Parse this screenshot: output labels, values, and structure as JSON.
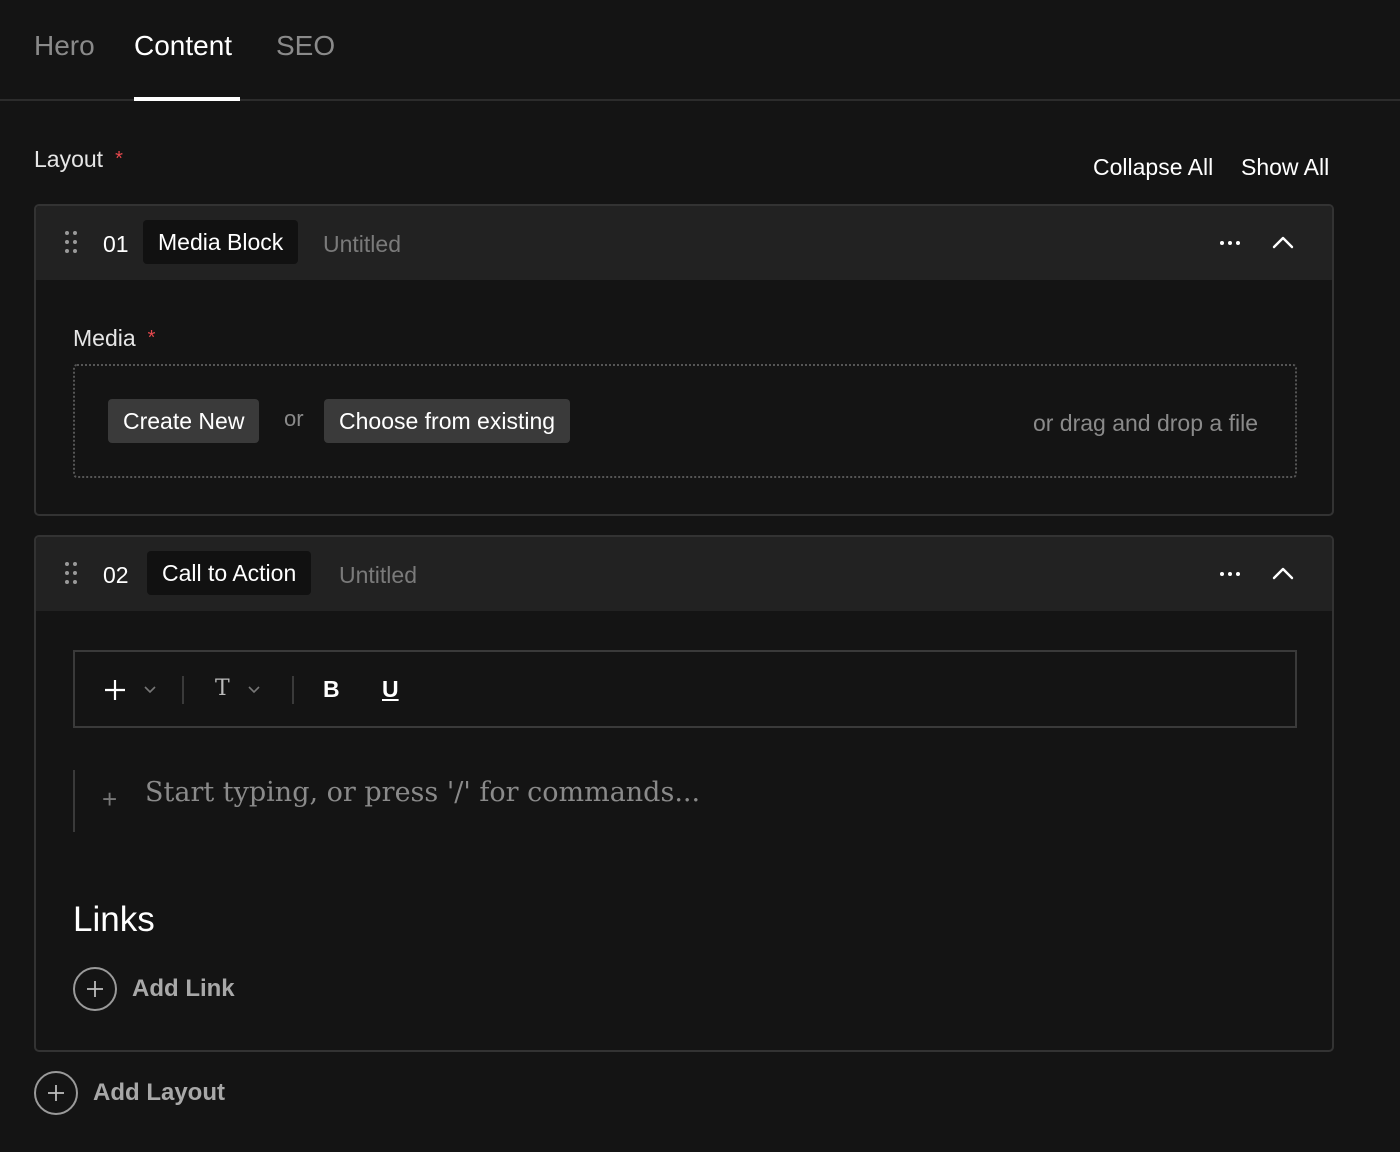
{
  "tabs": [
    {
      "label": "Hero",
      "active": false
    },
    {
      "label": "Content",
      "active": true
    },
    {
      "label": "SEO",
      "active": false
    }
  ],
  "layout_field": {
    "label": "Layout",
    "required_mark": "*",
    "collapse_all": "Collapse All",
    "show_all": "Show All"
  },
  "blocks": [
    {
      "number": "01",
      "type": "Media Block",
      "title": "Untitled",
      "media_field": {
        "label": "Media",
        "required_mark": "*",
        "create_new": "Create New",
        "or": "or",
        "choose_existing": "Choose from existing",
        "drag_drop": "or drag and drop a file"
      }
    },
    {
      "number": "02",
      "type": "Call to Action",
      "title": "Untitled",
      "editor": {
        "toolbar": {
          "insert_icon": "plus-icon",
          "text_style_label": "T",
          "bold_label": "B",
          "underline_label": "U"
        },
        "plus_glyph": "+",
        "placeholder": "Start typing, or press '/' for commands..."
      },
      "links": {
        "heading": "Links",
        "add_link": "Add Link"
      }
    }
  ],
  "add_layout": "Add Layout",
  "colors": {
    "background": "#141414",
    "block_header": "#222222",
    "required": "#e5484d",
    "muted_text": "#8a8a8a"
  }
}
